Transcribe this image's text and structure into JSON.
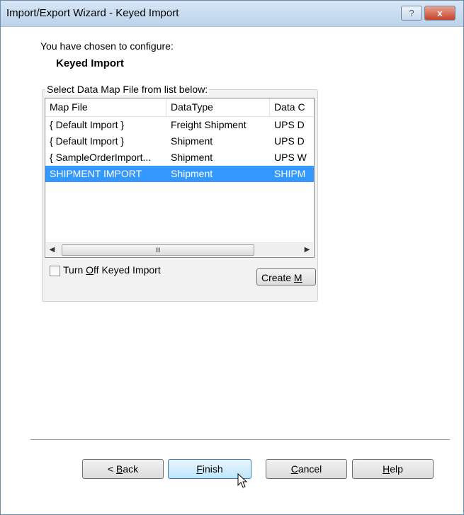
{
  "window": {
    "title": "Import/Export Wizard - Keyed Import",
    "help_glyph": "?",
    "close_glyph": "x"
  },
  "intro": {
    "line1": "You have chosen to configure:",
    "line2": "Keyed Import"
  },
  "group": {
    "legend": "Select Data Map File from list below:"
  },
  "listview": {
    "columns": [
      "Map File",
      "DataType",
      "Data C"
    ],
    "rows": [
      {
        "cells": [
          "{ Default Import }",
          "Freight Shipment",
          "UPS D"
        ],
        "selected": false
      },
      {
        "cells": [
          "{ Default Import }",
          "Shipment",
          "UPS D"
        ],
        "selected": false
      },
      {
        "cells": [
          "{ SampleOrderImport...",
          "Shipment",
          "UPS W"
        ],
        "selected": false
      },
      {
        "cells": [
          "SHIPMENT IMPORT",
          "Shipment",
          "SHIPM"
        ],
        "selected": true
      }
    ],
    "scroll_left": "◀",
    "scroll_right": "▶",
    "scroll_thumb_grip": "III"
  },
  "options": {
    "checkbox_prefix": "Turn ",
    "checkbox_mnemonic": "O",
    "checkbox_suffix": "ff Keyed Import",
    "checked": false,
    "create_prefix": "Create ",
    "create_mnemonic": "M"
  },
  "buttons": {
    "back_prefix": "< ",
    "back_mnemonic": "B",
    "back_suffix": "ack",
    "finish_mnemonic": "F",
    "finish_suffix": "inish",
    "cancel_mnemonic": "C",
    "cancel_suffix": "ancel",
    "help_mnemonic": "H",
    "help_suffix": "elp"
  },
  "colors": {
    "selection": "#3399ff",
    "close_button": "#c6432a",
    "finish_button": "#bee6fd"
  },
  "icons": {
    "help": "question-mark-icon",
    "close": "close-icon",
    "cursor": "mouse-pointer-icon"
  }
}
